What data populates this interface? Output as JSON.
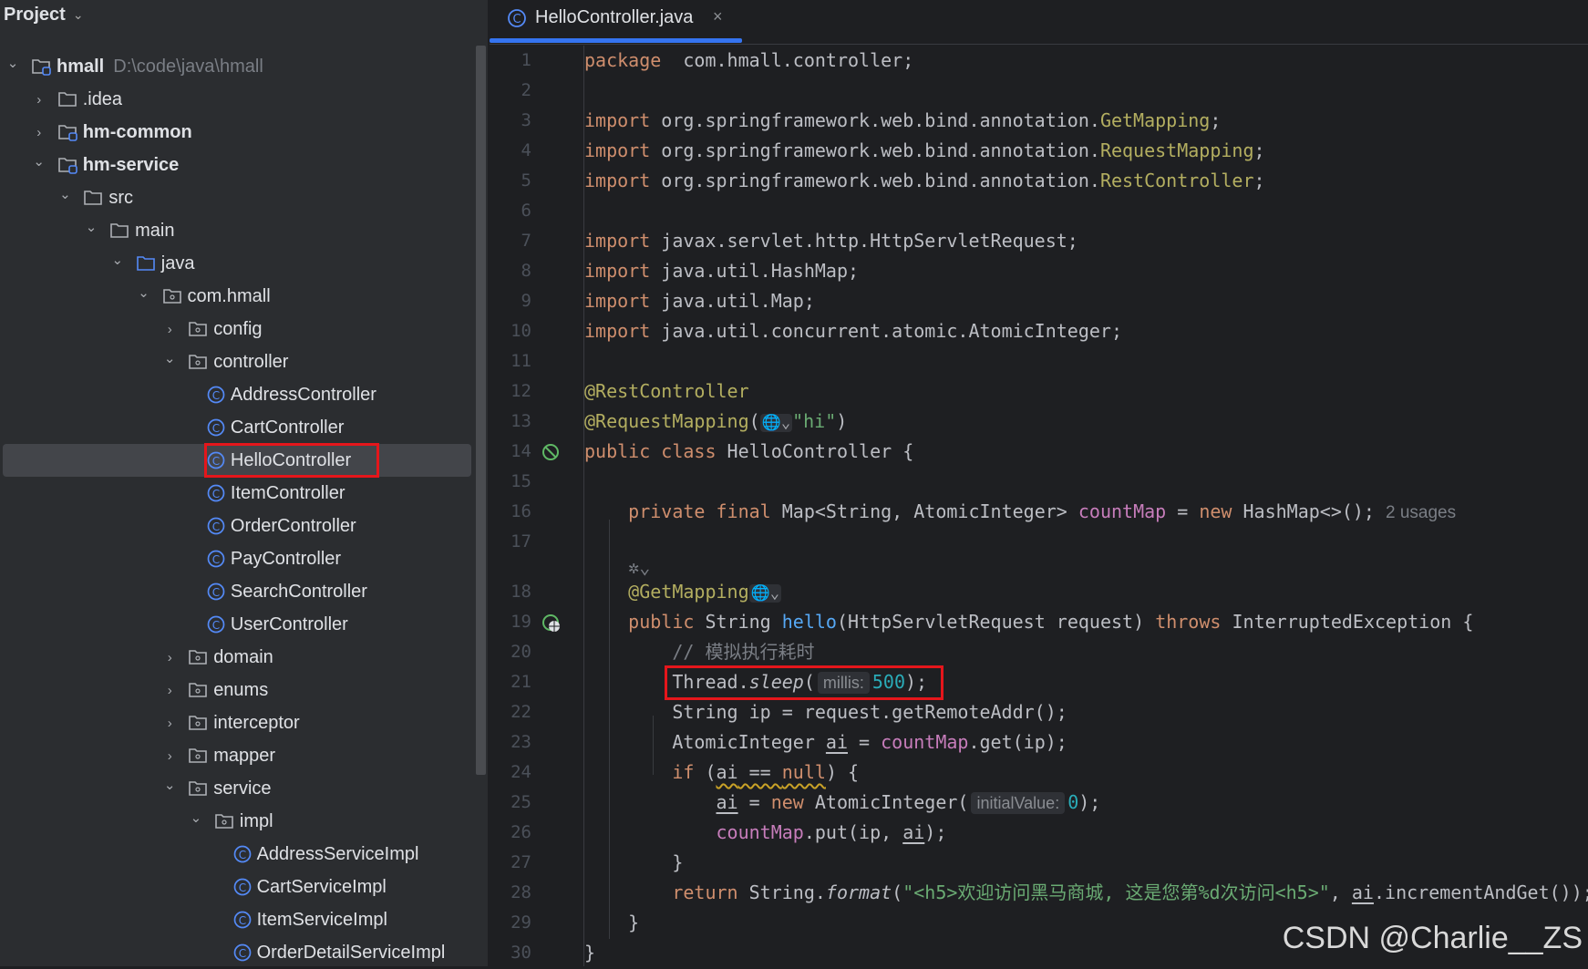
{
  "sidebar": {
    "title": "Project",
    "tree": [
      {
        "label": "hmall",
        "path": "D:\\code\\java\\hmall",
        "depth": 0,
        "type": "module",
        "expanded": true,
        "bold": true
      },
      {
        "label": ".idea",
        "depth": 1,
        "type": "folder",
        "expanded": false
      },
      {
        "label": "hm-common",
        "depth": 1,
        "type": "module",
        "expanded": false,
        "bold": true
      },
      {
        "label": "hm-service",
        "depth": 1,
        "type": "module",
        "expanded": true,
        "bold": true
      },
      {
        "label": "src",
        "depth": 2,
        "type": "folder",
        "expanded": true
      },
      {
        "label": "main",
        "depth": 3,
        "type": "folder",
        "expanded": true
      },
      {
        "label": "java",
        "depth": 4,
        "type": "source-folder",
        "expanded": true
      },
      {
        "label": "com.hmall",
        "depth": 5,
        "type": "package",
        "expanded": true
      },
      {
        "label": "config",
        "depth": 6,
        "type": "package",
        "expanded": false
      },
      {
        "label": "controller",
        "depth": 6,
        "type": "package",
        "expanded": true
      },
      {
        "label": "AddressController",
        "depth": 7,
        "type": "class"
      },
      {
        "label": "CartController",
        "depth": 7,
        "type": "class"
      },
      {
        "label": "HelloController",
        "depth": 7,
        "type": "class",
        "selected": true,
        "highlighted": true
      },
      {
        "label": "ItemController",
        "depth": 7,
        "type": "class"
      },
      {
        "label": "OrderController",
        "depth": 7,
        "type": "class"
      },
      {
        "label": "PayController",
        "depth": 7,
        "type": "class"
      },
      {
        "label": "SearchController",
        "depth": 7,
        "type": "class"
      },
      {
        "label": "UserController",
        "depth": 7,
        "type": "class"
      },
      {
        "label": "domain",
        "depth": 6,
        "type": "package",
        "expanded": false
      },
      {
        "label": "enums",
        "depth": 6,
        "type": "package",
        "expanded": false
      },
      {
        "label": "interceptor",
        "depth": 6,
        "type": "package",
        "expanded": false
      },
      {
        "label": "mapper",
        "depth": 6,
        "type": "package",
        "expanded": false
      },
      {
        "label": "service",
        "depth": 6,
        "type": "package",
        "expanded": true
      },
      {
        "label": "impl",
        "depth": 7,
        "type": "package",
        "expanded": true
      },
      {
        "label": "AddressServiceImpl",
        "depth": 8,
        "type": "class"
      },
      {
        "label": "CartServiceImpl",
        "depth": 8,
        "type": "class"
      },
      {
        "label": "ItemServiceImpl",
        "depth": 8,
        "type": "class"
      },
      {
        "label": "OrderDetailServiceImpl",
        "depth": 8,
        "type": "class"
      }
    ]
  },
  "tab": {
    "label": "HelloController.java",
    "icon": "class-icon",
    "close": "×"
  },
  "colors": {
    "accent": "#3574f0",
    "highlight": "#e5161b",
    "keyword": "#cf8e6d",
    "annotation": "#b3ae60",
    "string": "#6aab73",
    "field": "#c77dbb"
  },
  "editor": {
    "lines": [
      {
        "n": "1",
        "t": [
          [
            "kw",
            "package"
          ],
          [
            "",
            "  com.hmall.controller;"
          ]
        ]
      },
      {
        "n": "2",
        "t": []
      },
      {
        "n": "3",
        "t": [
          [
            "kw",
            "import"
          ],
          [
            "",
            " org.springframework.web.bind.annotation."
          ],
          [
            "ann",
            "GetMapping"
          ],
          [
            "",
            ";"
          ]
        ]
      },
      {
        "n": "4",
        "t": [
          [
            "kw",
            "import"
          ],
          [
            "",
            " org.springframework.web.bind.annotation."
          ],
          [
            "ann",
            "RequestMapping"
          ],
          [
            "",
            ";"
          ]
        ]
      },
      {
        "n": "5",
        "t": [
          [
            "kw",
            "import"
          ],
          [
            "",
            " org.springframework.web.bind.annotation."
          ],
          [
            "ann",
            "RestController"
          ],
          [
            "",
            ";"
          ]
        ]
      },
      {
        "n": "6",
        "t": []
      },
      {
        "n": "7",
        "t": [
          [
            "kw",
            "import"
          ],
          [
            "",
            " javax.servlet.http.HttpServletRequest;"
          ]
        ]
      },
      {
        "n": "8",
        "t": [
          [
            "kw",
            "import"
          ],
          [
            "",
            " java.util.HashMap;"
          ]
        ]
      },
      {
        "n": "9",
        "t": [
          [
            "kw",
            "import"
          ],
          [
            "",
            " java.util.Map;"
          ]
        ]
      },
      {
        "n": "10",
        "t": [
          [
            "kw",
            "import"
          ],
          [
            "",
            " java.util.concurrent.atomic.AtomicInteger;"
          ]
        ]
      },
      {
        "n": "11",
        "t": []
      },
      {
        "n": "12",
        "t": [
          [
            "ann",
            "@RestController"
          ]
        ]
      },
      {
        "n": "13",
        "t": [
          [
            "ann",
            "@RequestMapping"
          ],
          [
            "",
            "("
          ],
          [
            "globe",
            "🌐⌄"
          ],
          [
            "str",
            "\"hi\""
          ],
          [
            "",
            ")"
          ]
        ]
      },
      {
        "n": "14",
        "gutter": "bean-icon",
        "t": [
          [
            "kw",
            "public class "
          ],
          [
            "",
            "HelloController {"
          ]
        ]
      },
      {
        "n": "15",
        "t": []
      },
      {
        "n": "16",
        "t": [
          [
            "",
            "    "
          ],
          [
            "kw",
            "private final "
          ],
          [
            "",
            "Map<String, AtomicInteger> "
          ],
          [
            "fld",
            "countMap"
          ],
          [
            "",
            " = "
          ],
          [
            "kw",
            "new "
          ],
          [
            "",
            "HashMap<>();"
          ],
          [
            "usage",
            "2 usages"
          ]
        ]
      },
      {
        "n": "17",
        "t": []
      },
      {
        "n": "",
        "inlay": true,
        "t": [
          [
            "",
            "    "
          ],
          [
            "cm",
            "✲⌄"
          ]
        ]
      },
      {
        "n": "18",
        "t": [
          [
            "",
            "    "
          ],
          [
            "ann",
            "@GetMapping"
          ],
          [
            "globe",
            "🌐⌄"
          ]
        ]
      },
      {
        "n": "19",
        "gutter": "endpoint-icon",
        "t": [
          [
            "",
            "    "
          ],
          [
            "kw",
            "public "
          ],
          [
            "",
            "String "
          ],
          [
            "fn",
            "hello"
          ],
          [
            "",
            "(HttpServletRequest request) "
          ],
          [
            "kw",
            "throws "
          ],
          [
            "",
            "InterruptedException {"
          ]
        ]
      },
      {
        "n": "20",
        "t": [
          [
            "",
            "        "
          ],
          [
            "cm",
            "// 模拟执行耗时"
          ]
        ]
      },
      {
        "n": "21",
        "t": [
          [
            "",
            "        Thread."
          ],
          [
            "it",
            "sleep"
          ],
          [
            "",
            "("
          ],
          [
            "hint",
            "millis:"
          ],
          [
            "num2",
            "500"
          ],
          [
            "",
            ");"
          ]
        ]
      },
      {
        "n": "22",
        "t": [
          [
            "",
            "        String ip = request.getRemoteAddr();"
          ]
        ]
      },
      {
        "n": "23",
        "t": [
          [
            "",
            "        AtomicInteger "
          ],
          [
            "u",
            "ai"
          ],
          [
            "",
            " = "
          ],
          [
            "fld",
            "countMap"
          ],
          [
            "",
            ".get(ip);"
          ]
        ]
      },
      {
        "n": "24",
        "t": [
          [
            "",
            "        "
          ],
          [
            "kw",
            "if "
          ],
          [
            "",
            "("
          ],
          [
            "warn u",
            "ai"
          ],
          [
            "warn",
            " == "
          ],
          [
            "warn kw",
            "null"
          ],
          [
            "",
            ") {"
          ]
        ]
      },
      {
        "n": "25",
        "t": [
          [
            "",
            "            "
          ],
          [
            "u",
            "ai"
          ],
          [
            "",
            " = "
          ],
          [
            "kw",
            "new "
          ],
          [
            "",
            "AtomicInteger("
          ],
          [
            "hint",
            "initialValue:"
          ],
          [
            "num2",
            "0"
          ],
          [
            "",
            ");"
          ]
        ]
      },
      {
        "n": "26",
        "t": [
          [
            "",
            "            "
          ],
          [
            "fld",
            "countMap"
          ],
          [
            "",
            ".put(ip, "
          ],
          [
            "u",
            "ai"
          ],
          [
            "",
            ");"
          ]
        ]
      },
      {
        "n": "27",
        "t": [
          [
            "",
            "        }"
          ]
        ]
      },
      {
        "n": "28",
        "t": [
          [
            "",
            "        "
          ],
          [
            "kw",
            "return "
          ],
          [
            "",
            "String."
          ],
          [
            "it",
            "format"
          ],
          [
            "",
            "("
          ],
          [
            "str",
            "\"<h5>欢迎访问黑马商城, 这是您第%d次访问<h5>\""
          ],
          [
            "",
            ", "
          ],
          [
            "u",
            "ai"
          ],
          [
            "",
            ".incrementAndGet());"
          ]
        ]
      },
      {
        "n": "29",
        "t": [
          [
            "",
            "    }"
          ]
        ]
      },
      {
        "n": "30",
        "t": [
          [
            "",
            "}"
          ]
        ]
      }
    ]
  },
  "watermark": "CSDN @Charlie__ZS"
}
